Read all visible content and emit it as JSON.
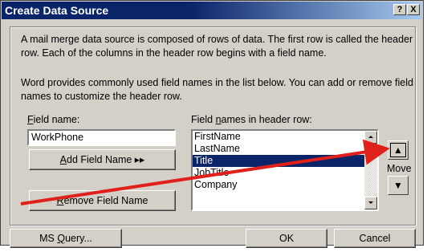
{
  "window": {
    "title": "Create Data Source",
    "help_label": "?",
    "close_label": "X"
  },
  "description": {
    "para1": "A mail merge data source is composed of rows of data. The first row is called the header row. Each of the columns in the header row begins with a field name.",
    "para2": "Word provides commonly used field names in the list below. You can add or remove field names to customize the header row."
  },
  "field_name": {
    "label_accel": "F",
    "label_rest": "ield name:",
    "value": "WorkPhone"
  },
  "buttons": {
    "add_field_accel": "A",
    "add_field_rest": "dd Field Name ▸▸",
    "remove_field_accel": "R",
    "remove_field_rest": "emove Field Name",
    "ms_query_pre": "MS ",
    "ms_query_accel": "Q",
    "ms_query_post": "uery...",
    "ok": "OK",
    "cancel": "Cancel",
    "move_up": "▲",
    "move_down": "▼",
    "move_label": "Move"
  },
  "header_list": {
    "label_pre": "Field ",
    "label_accel": "n",
    "label_post": "ames in header row:",
    "items": [
      "FirstName",
      "LastName",
      "Title",
      "JobTitle",
      "Company"
    ],
    "selected_index": 2
  },
  "colors": {
    "title_bar": "#0a246a",
    "selection": "#0a246a",
    "arrow": "#e0201a",
    "dialog_bg": "#d4d0c8"
  }
}
